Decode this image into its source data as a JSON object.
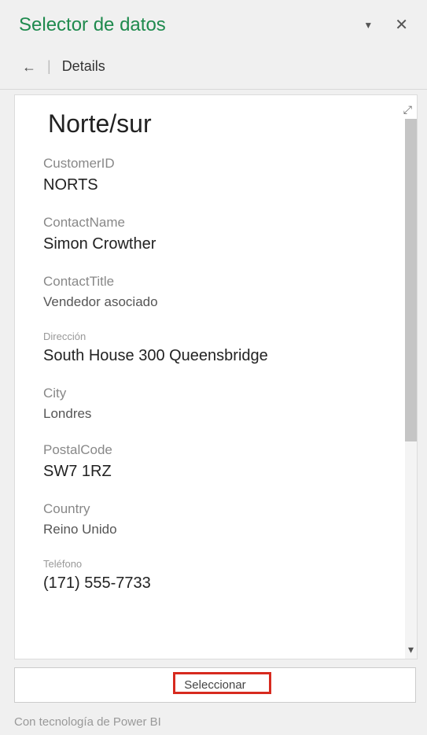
{
  "pane": {
    "title": "Selector de datos"
  },
  "breadcrumb": {
    "label": "Details"
  },
  "card": {
    "title": "Norte/sur"
  },
  "fields": {
    "customerId": {
      "label": "CustomerID",
      "value": "NORTS"
    },
    "contactName": {
      "label": "ContactName",
      "value": "Simon Crowther"
    },
    "contactTitle": {
      "label": "ContactTitle",
      "value": "Vendedor asociado"
    },
    "direccion": {
      "label": "Dirección",
      "value": "South House 300 Queensbridge"
    },
    "city": {
      "label": "City",
      "value": "Londres"
    },
    "postalCode": {
      "label": "PostalCode",
      "value": "SW7 1RZ"
    },
    "country": {
      "label": "Country",
      "value": "Reino Unido"
    },
    "telefono": {
      "label": "Teléfono",
      "value": "(171) 555-7733"
    }
  },
  "actions": {
    "selectLabel": "Seleccionar"
  },
  "footer": {
    "poweredBy": "Con tecnología de Power BI"
  }
}
